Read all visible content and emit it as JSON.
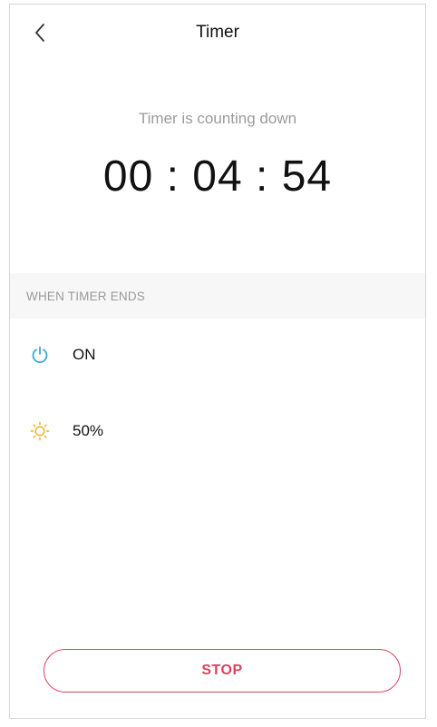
{
  "header": {
    "title": "Timer",
    "back_icon": "chevron-left-icon"
  },
  "timer": {
    "status": "Timer is counting down",
    "countdown": "00 : 04 : 54"
  },
  "when_timer_ends": {
    "section_title": "WHEN TIMER ENDS",
    "items": [
      {
        "icon": "power-icon",
        "label": "ON",
        "icon_color": "#3ba9d9"
      },
      {
        "icon": "brightness-icon",
        "label": "50%",
        "icon_color": "#f2b01e"
      }
    ]
  },
  "actions": {
    "stop_label": "STOP",
    "accent_color": "#e0405f"
  }
}
